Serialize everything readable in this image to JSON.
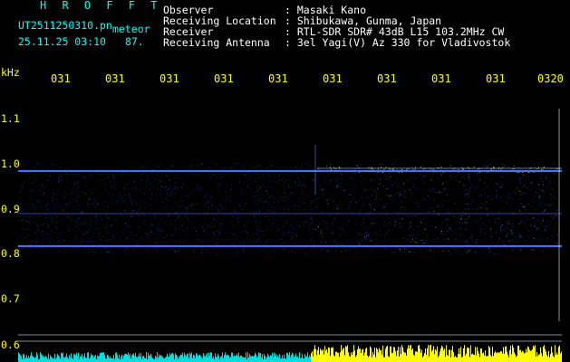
{
  "header": {
    "brand": "H R O F F T",
    "filename": "UT2511250310.pn",
    "meteor_label": "meteor",
    "datetime": "25.11.25 03:10",
    "count": "87."
  },
  "info": [
    {
      "label": "Observer",
      "value": ": Masaki Kano"
    },
    {
      "label": "Receiving Location",
      "value": ": Shibukawa, Gunma, Japan"
    },
    {
      "label": "Receiver",
      "value": ": RTL-SDR SDR# 43dB L15 103.2MHz CW"
    },
    {
      "label": "Receiving Antenna",
      "value": ": 3el Yagi(V) Az 330 for Vladivostok"
    }
  ],
  "axis": {
    "unit": "kHz",
    "y_ticks": [
      "1.1",
      "1.0",
      "0.9",
      "0.8",
      "0.7",
      "0.6"
    ],
    "x_ticks": [
      "031",
      "031",
      "031",
      "031",
      "031",
      "031",
      "031",
      "031",
      "031",
      "0320"
    ]
  },
  "colors": {
    "header_text": "#00ffff",
    "info_text": "#ffffff",
    "axis_text": "#ffff00",
    "background": "#000000",
    "signal": "#3b6cff",
    "hot_signal": "#ffff66"
  }
}
